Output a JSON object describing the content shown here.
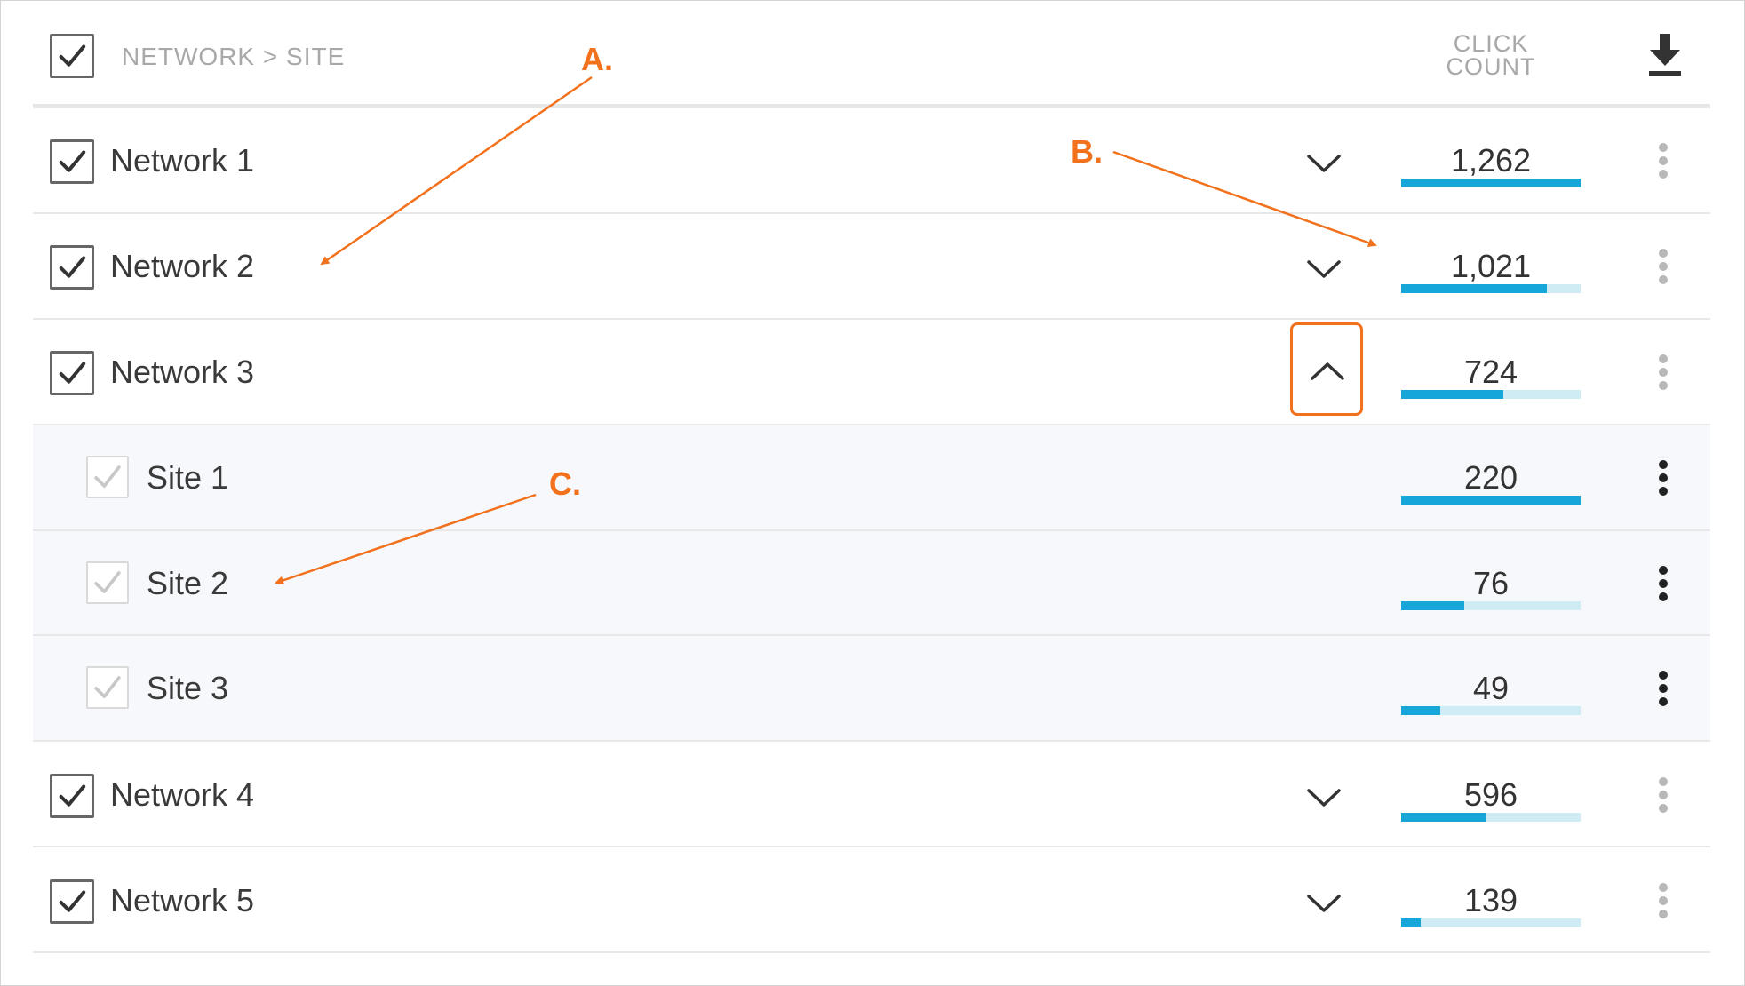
{
  "header": {
    "breadcrumb": "NETWORK > SITE",
    "click_count_label_line1": "CLICK",
    "click_count_label_line2": "COUNT",
    "download_icon": "download-icon"
  },
  "rows": [
    {
      "label": "Network 1",
      "count": "1,262",
      "fill": 1.0,
      "type": "network",
      "expanded": false
    },
    {
      "label": "Network 2",
      "count": "1,021",
      "fill": 0.81,
      "type": "network",
      "expanded": false
    },
    {
      "label": "Network 3",
      "count": "724",
      "fill": 0.57,
      "type": "network",
      "expanded": true
    },
    {
      "label": "Site 1",
      "count": "220",
      "fill": 1.0,
      "type": "site"
    },
    {
      "label": "Site 2",
      "count": "76",
      "fill": 0.35,
      "type": "site"
    },
    {
      "label": "Site 3",
      "count": "49",
      "fill": 0.22,
      "type": "site"
    },
    {
      "label": "Network 4",
      "count": "596",
      "fill": 0.47,
      "type": "network",
      "expanded": false
    },
    {
      "label": "Network 5",
      "count": "139",
      "fill": 0.11,
      "type": "network",
      "expanded": false
    }
  ],
  "annotations": {
    "a": "A.",
    "b": "B.",
    "c": "C."
  },
  "colors": {
    "accent_bar": "#17a6d8",
    "bar_track": "#cfecf5",
    "annotation": "#f2711c",
    "site_row_bg": "#f7f8fb"
  }
}
